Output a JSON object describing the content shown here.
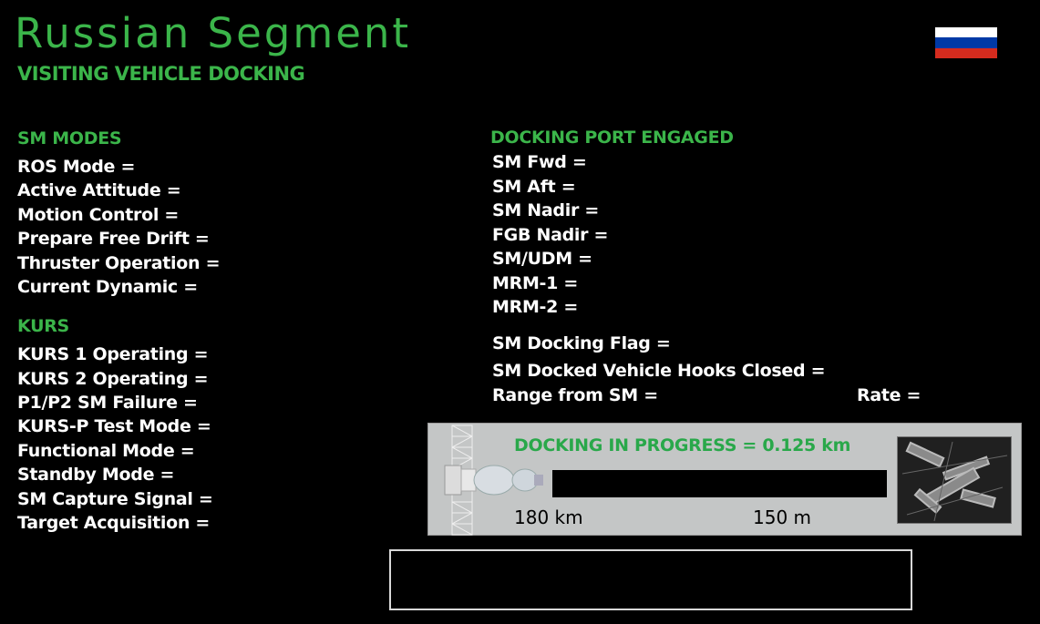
{
  "header": {
    "title": "Russian Segment",
    "subtitle": "VISITING VEHICLE DOCKING"
  },
  "flag": {
    "colors": [
      "#ffffff",
      "#0039a6",
      "#d52b1e"
    ]
  },
  "sm_modes": {
    "heading": "SM MODES",
    "items": [
      "ROS Mode =",
      "Active Attitude =",
      "Motion Control =",
      "Prepare Free Drift =",
      "Thruster Operation =",
      "Current Dynamic ="
    ]
  },
  "kurs": {
    "heading": "KURS",
    "items": [
      "KURS 1 Operating =",
      "KURS 2 Operating =",
      "P1/P2 SM Failure =",
      "KURS-P Test Mode =",
      "Functional Mode =",
      "Standby Mode =",
      "SM Capture Signal =",
      "Target Acquisition ="
    ]
  },
  "docking_port": {
    "heading": "DOCKING PORT ENGAGED",
    "items": [
      "SM Fwd =",
      "SM Aft =",
      "SM Nadir =",
      "FGB Nadir =",
      "SM/UDM =",
      "MRM-1 =",
      "MRM-2 ="
    ]
  },
  "status": {
    "docking_flag": "SM Docking Flag =",
    "hooks_closed": "SM Docked Vehicle Hooks Closed =",
    "range": "Range from SM =",
    "rate": "Rate ="
  },
  "progress_panel": {
    "label": "DOCKING IN PROGRESS = 0.125 km",
    "scale_left": "180 km",
    "scale_right": "150 m"
  },
  "colors": {
    "accent_green": "#3bb54a",
    "panel_bg": "#c4c6c6"
  }
}
